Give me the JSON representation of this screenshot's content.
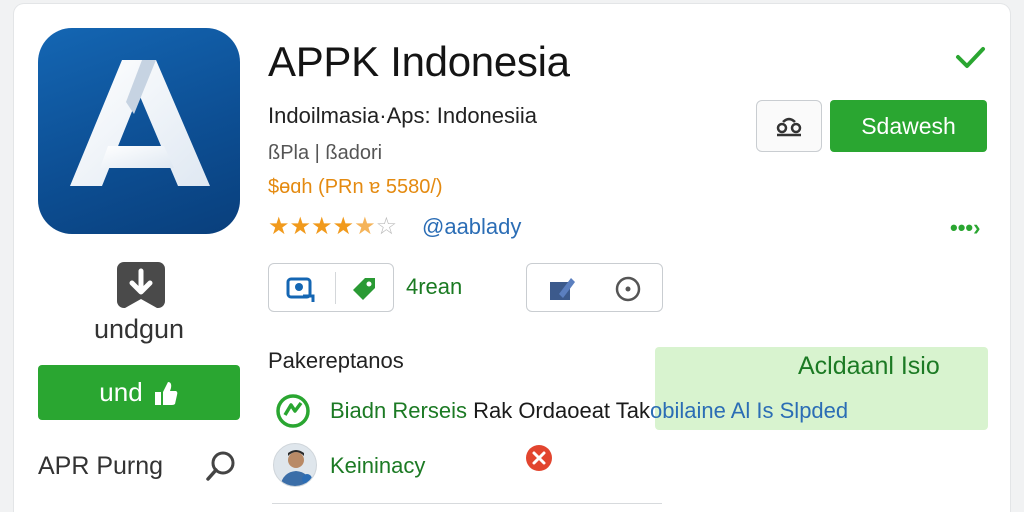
{
  "app": {
    "title": "APPK Indonesia",
    "subtitle": "Indoilmasia·Aps: Indonesiia",
    "meta": "ßPla | ßadori",
    "price": "$ɵɑh (PRn ɐ 5580/)",
    "rating_stars": "★★★★",
    "rating_half": "★",
    "rating_empty": "☆",
    "rating_value": 4.5,
    "handle": "@aablady"
  },
  "left_panel": {
    "download_label": "undgun",
    "und_button_label": "und",
    "apr_label": "APR Purng"
  },
  "actions": {
    "primary_button_label": "Sdawesh",
    "rean_label": "4rean"
  },
  "section": {
    "title": "Pakereptanos",
    "highlight_title": "Acldaanl Isio",
    "row1": {
      "part1": "Biadn Rerseis ",
      "part2": "Rak Ordaoeat Tak",
      "part3": "obilaine Al Is Slpded"
    },
    "row2": {
      "label": "Keininacy"
    }
  },
  "colors": {
    "brand_green": "#2aa631",
    "icon_blue": "#1466b3",
    "star_orange": "#f19a1c",
    "link_blue": "#2b6db5",
    "highlight_bg": "#d8f3cf"
  },
  "icons": [
    "app-logo-icon",
    "download-icon",
    "thumbs-up-icon",
    "search-icon",
    "check-icon",
    "share-icon",
    "more-icon",
    "image-icon",
    "tag-icon",
    "edit-icon",
    "clock-icon",
    "refresh-icon",
    "close-icon"
  ]
}
